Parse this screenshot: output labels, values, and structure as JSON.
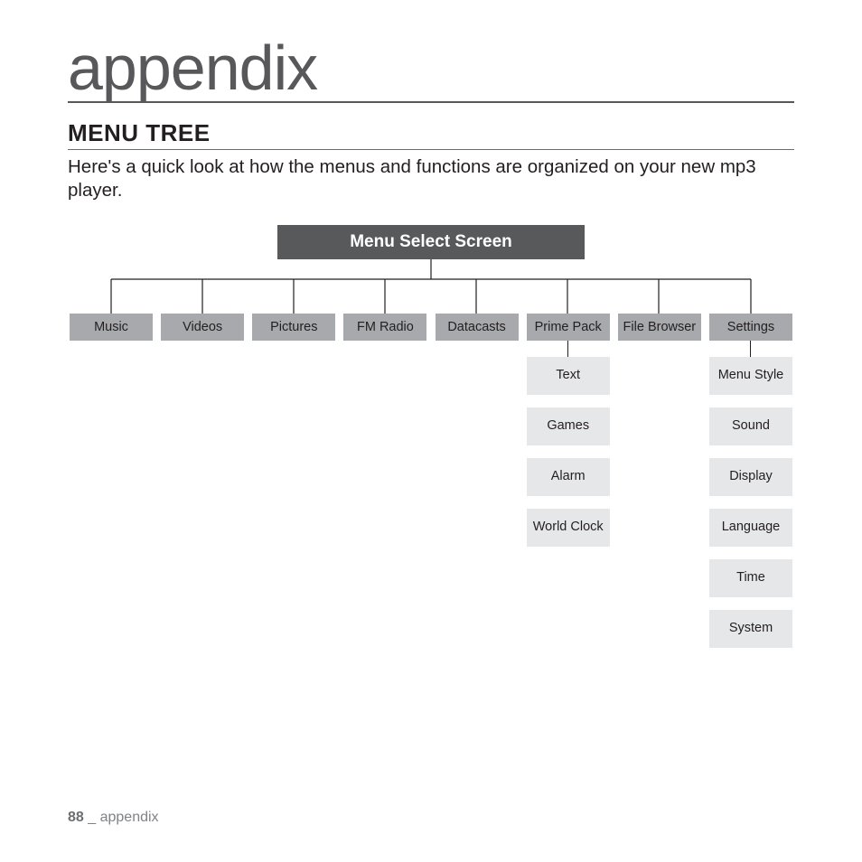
{
  "page_title": "appendix",
  "section_title": "MENU TREE",
  "intro": "Here's a quick look at how the menus and functions are organized on your new mp3 player.",
  "tree": {
    "root": "Menu Select Screen",
    "main": [
      "Music",
      "Videos",
      "Pictures",
      "FM Radio",
      "Datacasts",
      "Prime Pack",
      "File Browser",
      "Settings"
    ],
    "prime_pack": [
      "Text",
      "Games",
      "Alarm",
      "World Clock"
    ],
    "settings": [
      "Menu Style",
      "Sound",
      "Display",
      "Language",
      "Time",
      "System"
    ]
  },
  "footer": {
    "page_number": "88",
    "sep": " _ ",
    "section": "appendix"
  }
}
